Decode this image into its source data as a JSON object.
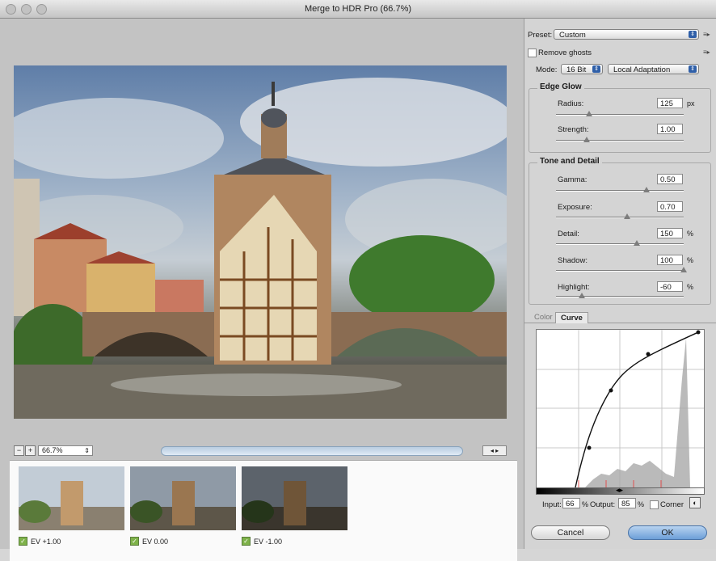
{
  "window": {
    "title": "Merge to HDR Pro (66.7%)"
  },
  "preview": {
    "zoom_value": "66.7%",
    "zoom_minus": "−",
    "zoom_plus": "+"
  },
  "exposures": [
    {
      "label": "EV +1.00",
      "checked": true
    },
    {
      "label": "EV 0.00",
      "checked": true
    },
    {
      "label": "EV -1.00",
      "checked": true
    }
  ],
  "panel": {
    "preset_label": "Preset:",
    "preset_value": "Custom",
    "remove_ghosts_label": "Remove ghosts",
    "mode_label": "Mode:",
    "mode_bit": "16 Bit",
    "mode_method": "Local Adaptation",
    "edge_glow": {
      "title": "Edge Glow",
      "radius_label": "Radius:",
      "radius_value": "125",
      "radius_unit": "px",
      "radius_pos": 0.26,
      "strength_label": "Strength:",
      "strength_value": "1.00",
      "strength_pos": 0.24
    },
    "tone_detail": {
      "title": "Tone and Detail",
      "gamma_label": "Gamma:",
      "gamma_value": "0.50",
      "gamma_pos": 0.71,
      "exposure_label": "Exposure:",
      "exposure_value": "0.70",
      "exposure_pos": 0.56,
      "detail_label": "Detail:",
      "detail_value": "150",
      "detail_unit": "%",
      "detail_pos": 0.63,
      "shadow_label": "Shadow:",
      "shadow_value": "100",
      "shadow_unit": "%",
      "shadow_pos": 1.0,
      "highlight_label": "Highlight:",
      "highlight_value": "-60",
      "highlight_unit": "%",
      "highlight_pos": 0.2
    },
    "tabs": [
      "Color",
      "Curve"
    ],
    "curve": {
      "input_label": "Input:",
      "input_value": "66",
      "input_unit": "%",
      "output_label": "Output:",
      "output_value": "85",
      "output_unit": "%",
      "corner_label": "Corner"
    },
    "cancel_label": "Cancel",
    "ok_label": "OK"
  }
}
